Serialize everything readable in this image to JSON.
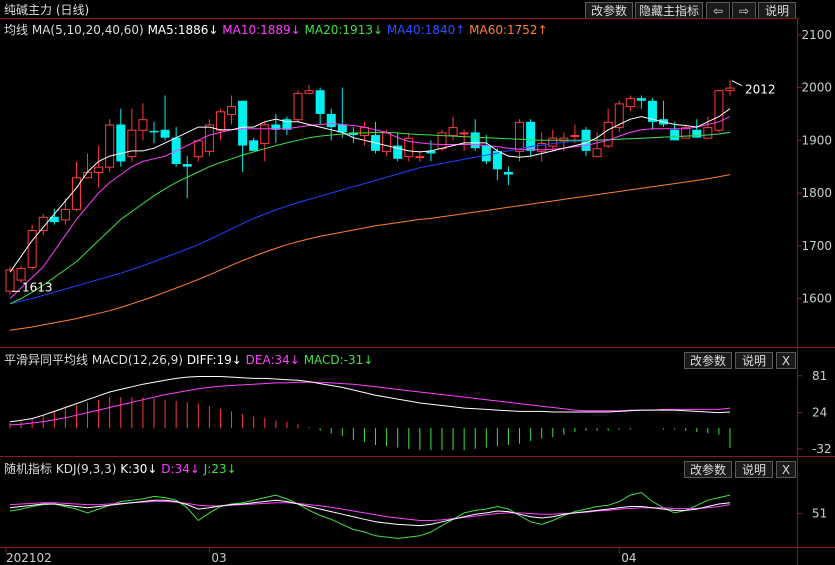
{
  "title": "纯碱主力 (日线)",
  "buttons": {
    "params": "改参数",
    "hide_indicator": "隐藏主指标",
    "back_arrow": "⇦",
    "fwd_arrow": "⇨",
    "help": "说明",
    "close": "X"
  },
  "legend": {
    "prefix": "均线",
    "ma_param": "MA(5,10,20,40,60)",
    "ma5": "MA5:1886↓",
    "ma10": "MA10:1889↓",
    "ma20": "MA20:1913↓",
    "ma40": "MA40:1840↑",
    "ma60": "MA60:1752↑"
  },
  "macd_legend": {
    "prefix": "平滑异同平均线",
    "param": "MACD(12,26,9)",
    "diff": "DIFF:19↓",
    "dea": "DEA:34↓",
    "macd": "MACD:-31↓"
  },
  "kdj_legend": {
    "prefix": "随机指标",
    "param": "KDJ(9,3,3)",
    "k": "K:30↓",
    "d": "D:34↓",
    "j": "J:23↓"
  },
  "colors": {
    "up": "#ff3b3b",
    "down": "#00f0f0",
    "ma5": "#ffffff",
    "ma10": "#ff40ff",
    "ma20": "#40e040",
    "ma40": "#2040ff",
    "ma60": "#ff8030",
    "dea": "#ff40ff",
    "macd_pos": "#ff3b3b",
    "macd_neg": "#40e040"
  },
  "chart_data": [
    {
      "type": "candlestick",
      "ylim": [
        1510,
        2130
      ],
      "yticks": [
        "2100",
        "2000",
        "1900",
        "1800",
        "1700",
        "1600"
      ],
      "xticks": [
        "202102",
        "03",
        "04"
      ],
      "annotations": {
        "low_label": "1613",
        "high_label": "2012"
      },
      "candles": [
        [
          1615,
          1655,
          1660,
          1608
        ],
        [
          1636,
          1658,
          1662,
          1630
        ],
        [
          1660,
          1730,
          1740,
          1655
        ],
        [
          1730,
          1755,
          1760,
          1720
        ],
        [
          1755,
          1745,
          1770,
          1740
        ],
        [
          1750,
          1770,
          1790,
          1740
        ],
        [
          1770,
          1830,
          1860,
          1765
        ],
        [
          1830,
          1840,
          1875,
          1830
        ],
        [
          1840,
          1850,
          1890,
          1810
        ],
        [
          1850,
          1930,
          1940,
          1840
        ],
        [
          1930,
          1860,
          1960,
          1850
        ],
        [
          1870,
          1920,
          1960,
          1860
        ],
        [
          1920,
          1940,
          1970,
          1900
        ],
        [
          1918,
          1915,
          1935,
          1895
        ],
        [
          1920,
          1905,
          1985,
          1900
        ],
        [
          1905,
          1855,
          1925,
          1850
        ],
        [
          1855,
          1850,
          1870,
          1790
        ],
        [
          1870,
          1900,
          1900,
          1860
        ],
        [
          1880,
          1930,
          1940,
          1870
        ],
        [
          1920,
          1955,
          1960,
          1900
        ],
        [
          1950,
          1965,
          1985,
          1930
        ],
        [
          1975,
          1890,
          1975,
          1840
        ],
        [
          1900,
          1880,
          1905,
          1880
        ],
        [
          1895,
          1930,
          1935,
          1860
        ],
        [
          1930,
          1920,
          1950,
          1895
        ],
        [
          1940,
          1920,
          1945,
          1910
        ],
        [
          1940,
          1990,
          1995,
          1935
        ],
        [
          1990,
          1995,
          2005,
          1990
        ],
        [
          1995,
          1950,
          2000,
          1930
        ],
        [
          1950,
          1925,
          1960,
          1900
        ],
        [
          1930,
          1915,
          2000,
          1905
        ],
        [
          1915,
          1910,
          1925,
          1895
        ],
        [
          1910,
          1925,
          1935,
          1890
        ],
        [
          1910,
          1880,
          1935,
          1875
        ],
        [
          1880,
          1915,
          1920,
          1870
        ],
        [
          1890,
          1865,
          1915,
          1860
        ],
        [
          1870,
          1905,
          1915,
          1860
        ],
        [
          1870,
          1870,
          1880,
          1860
        ],
        [
          1880,
          1875,
          1900,
          1860
        ],
        [
          1885,
          1915,
          1920,
          1880
        ],
        [
          1910,
          1925,
          1945,
          1900
        ],
        [
          1915,
          1915,
          1920,
          1880
        ],
        [
          1915,
          1885,
          1940,
          1880
        ],
        [
          1890,
          1860,
          1910,
          1855
        ],
        [
          1880,
          1845,
          1885,
          1825
        ],
        [
          1840,
          1835,
          1850,
          1815
        ],
        [
          1880,
          1935,
          1940,
          1860
        ],
        [
          1935,
          1880,
          1940,
          1870
        ],
        [
          1880,
          1895,
          1915,
          1860
        ],
        [
          1890,
          1905,
          1920,
          1880
        ],
        [
          1900,
          1905,
          1915,
          1880
        ],
        [
          1910,
          1910,
          1930,
          1895
        ],
        [
          1920,
          1880,
          1925,
          1870
        ],
        [
          1870,
          1885,
          1915,
          1870
        ],
        [
          1890,
          1935,
          1960,
          1885
        ],
        [
          1925,
          1970,
          1975,
          1915
        ],
        [
          1965,
          1980,
          1985,
          1955
        ],
        [
          1980,
          1975,
          1985,
          1960
        ],
        [
          1975,
          1935,
          1980,
          1920
        ],
        [
          1940,
          1930,
          1975,
          1925
        ],
        [
          1920,
          1900,
          1935,
          1900
        ],
        [
          1905,
          1925,
          1930,
          1905
        ],
        [
          1920,
          1905,
          1940,
          1905
        ],
        [
          1905,
          1925,
          1945,
          1905
        ],
        [
          1920,
          1995,
          1995,
          1915
        ],
        [
          1995,
          2000,
          2015,
          1985
        ]
      ],
      "ma5": [
        1650,
        1680,
        1710,
        1735,
        1760,
        1785,
        1810,
        1840,
        1860,
        1870,
        1875,
        1880,
        1880,
        1885,
        1895,
        1905,
        1915,
        1925,
        1925,
        1920,
        1920,
        1925,
        1925,
        1935,
        1940,
        1935,
        1935,
        1930,
        1925,
        1920,
        1915,
        1905,
        1900,
        1895,
        1890,
        1885,
        1880,
        1878,
        1880,
        1885,
        1890,
        1895,
        1895,
        1895,
        1880,
        1870,
        1868,
        1870,
        1875,
        1880,
        1885,
        1890,
        1895,
        1905,
        1920,
        1930,
        1940,
        1945,
        1940,
        1935,
        1930,
        1928,
        1925,
        1935,
        1945,
        1960
      ],
      "ma10": [
        1600,
        1620,
        1640,
        1660,
        1690,
        1720,
        1750,
        1775,
        1800,
        1820,
        1835,
        1850,
        1860,
        1865,
        1870,
        1880,
        1890,
        1900,
        1910,
        1915,
        1920,
        1922,
        1922,
        1922,
        1922,
        1922,
        1925,
        1928,
        1930,
        1932,
        1930,
        1928,
        1925,
        1920,
        1915,
        1905,
        1898,
        1895,
        1893,
        1892,
        1892,
        1892,
        1892,
        1890,
        1888,
        1885,
        1883,
        1882,
        1882,
        1883,
        1885,
        1888,
        1890,
        1895,
        1900,
        1908,
        1915,
        1920,
        1922,
        1922,
        1922,
        1922,
        1925,
        1930,
        1935,
        1945
      ],
      "ma20": [
        1590,
        1600,
        1612,
        1625,
        1640,
        1655,
        1670,
        1690,
        1710,
        1730,
        1750,
        1765,
        1780,
        1795,
        1808,
        1820,
        1830,
        1840,
        1850,
        1858,
        1865,
        1872,
        1878,
        1884,
        1890,
        1895,
        1900,
        1905,
        1908,
        1910,
        1912,
        1913,
        1914,
        1915,
        1915,
        1914,
        1912,
        1911,
        1910,
        1909,
        1908,
        1907,
        1906,
        1905,
        1904,
        1903,
        1902,
        1901,
        1900,
        1900,
        1900,
        1900,
        1900,
        1900,
        1901,
        1902,
        1903,
        1904,
        1905,
        1906,
        1907,
        1908,
        1909,
        1910,
        1912,
        1915
      ],
      "ma40": [
        1590,
        1595,
        1600,
        1606,
        1612,
        1618,
        1624,
        1630,
        1636,
        1642,
        1648,
        1655,
        1662,
        1670,
        1678,
        1686,
        1694,
        1702,
        1712,
        1722,
        1732,
        1742,
        1752,
        1760,
        1768,
        1775,
        1782,
        1788,
        1794,
        1800,
        1806,
        1812,
        1818,
        1824,
        1830,
        1836,
        1842,
        1848,
        1852,
        1856,
        1860,
        1864,
        1868,
        1872,
        1876,
        1880,
        1884,
        1888,
        1891,
        1894,
        1896,
        1898,
        1899,
        1900,
        1901,
        1902,
        1903,
        1904,
        1905,
        1906,
        1907,
        1908,
        1909,
        1910,
        1912,
        1915
      ],
      "ma60": [
        1540,
        1543,
        1546,
        1550,
        1554,
        1558,
        1562,
        1567,
        1572,
        1577,
        1583,
        1590,
        1597,
        1604,
        1612,
        1620,
        1628,
        1636,
        1645,
        1654,
        1663,
        1672,
        1680,
        1688,
        1695,
        1702,
        1708,
        1713,
        1718,
        1722,
        1726,
        1730,
        1734,
        1738,
        1741,
        1744,
        1747,
        1750,
        1752,
        1755,
        1758,
        1761,
        1764,
        1767,
        1770,
        1773,
        1776,
        1779,
        1782,
        1785,
        1788,
        1791,
        1794,
        1797,
        1800,
        1803,
        1806,
        1809,
        1812,
        1815,
        1818,
        1821,
        1824,
        1827,
        1831,
        1835
      ]
    },
    {
      "type": "macd",
      "ylim": [
        -40,
        90
      ],
      "yticks": [
        "81",
        "24",
        "-32"
      ],
      "diff": [
        10,
        12,
        15,
        20,
        26,
        32,
        38,
        44,
        50,
        56,
        60,
        64,
        68,
        71,
        74,
        77,
        79,
        80,
        80,
        80,
        79,
        78,
        77,
        77,
        76,
        75,
        74,
        72,
        69,
        66,
        63,
        59,
        55,
        51,
        48,
        45,
        42,
        39,
        37,
        35,
        33,
        31,
        30,
        29,
        28,
        27,
        26,
        26,
        26,
        25,
        25,
        25,
        25,
        25,
        25,
        26,
        27,
        28,
        28,
        28,
        28,
        27,
        26,
        25,
        24,
        25
      ],
      "dea": [
        5,
        6,
        8,
        10,
        13,
        16,
        20,
        24,
        28,
        32,
        36,
        40,
        44,
        48,
        52,
        55,
        58,
        61,
        63,
        65,
        66,
        67,
        68,
        69,
        70,
        70,
        71,
        71,
        71,
        70,
        69,
        68,
        66,
        64,
        62,
        60,
        58,
        56,
        54,
        52,
        50,
        48,
        46,
        44,
        42,
        40,
        38,
        36,
        34,
        32,
        30,
        28,
        27,
        27,
        27,
        27,
        28,
        28,
        28,
        29,
        29,
        29,
        29,
        29,
        29,
        31
      ],
      "macd": [
        8,
        10,
        14,
        20,
        26,
        32,
        36,
        40,
        44,
        48,
        48,
        48,
        48,
        46,
        44,
        42,
        40,
        38,
        34,
        30,
        26,
        22,
        18,
        16,
        12,
        10,
        6,
        2,
        -4,
        -8,
        -12,
        -18,
        -22,
        -26,
        -28,
        -30,
        -32,
        -34,
        -34,
        -34,
        -34,
        -34,
        -32,
        -30,
        -28,
        -26,
        -24,
        -20,
        -16,
        -14,
        -10,
        -6,
        -4,
        -4,
        -4,
        -2,
        -2,
        0,
        0,
        -2,
        -2,
        -4,
        -6,
        -8,
        -10,
        -31
      ]
    },
    {
      "type": "kdj",
      "ylim": [
        0,
        110
      ],
      "yticks": [
        "51"
      ],
      "k": [
        60,
        62,
        64,
        66,
        66,
        64,
        62,
        60,
        62,
        64,
        66,
        68,
        70,
        72,
        72,
        70,
        65,
        58,
        60,
        63,
        65,
        66,
        68,
        70,
        72,
        70,
        66,
        62,
        58,
        54,
        50,
        46,
        42,
        38,
        36,
        34,
        33,
        32,
        34,
        38,
        42,
        46,
        50,
        52,
        55,
        54,
        50,
        46,
        44,
        46,
        50,
        52,
        54,
        56,
        58,
        60,
        62,
        62,
        60,
        58,
        56,
        56,
        58,
        62,
        66,
        68
      ],
      "d": [
        65,
        66,
        67,
        68,
        68,
        67,
        66,
        65,
        65,
        66,
        67,
        68,
        69,
        70,
        70,
        69,
        67,
        64,
        63,
        63,
        64,
        65,
        66,
        67,
        68,
        68,
        67,
        65,
        63,
        61,
        58,
        55,
        52,
        49,
        46,
        44,
        42,
        40,
        40,
        41,
        43,
        45,
        47,
        49,
        51,
        52,
        52,
        51,
        50,
        50,
        51,
        52,
        53,
        55,
        56,
        58,
        59,
        60,
        60,
        60,
        59,
        59,
        59,
        60,
        62,
        65
      ],
      "j": [
        55,
        58,
        62,
        65,
        66,
        62,
        58,
        52,
        58,
        64,
        70,
        72,
        74,
        78,
        76,
        72,
        60,
        40,
        52,
        62,
        66,
        68,
        72,
        76,
        80,
        74,
        66,
        56,
        48,
        42,
        34,
        26,
        22,
        16,
        14,
        12,
        14,
        16,
        22,
        32,
        42,
        52,
        56,
        58,
        62,
        58,
        48,
        38,
        34,
        40,
        48,
        54,
        58,
        62,
        64,
        70,
        80,
        84,
        70,
        60,
        52,
        56,
        64,
        72,
        76,
        80
      ]
    }
  ]
}
